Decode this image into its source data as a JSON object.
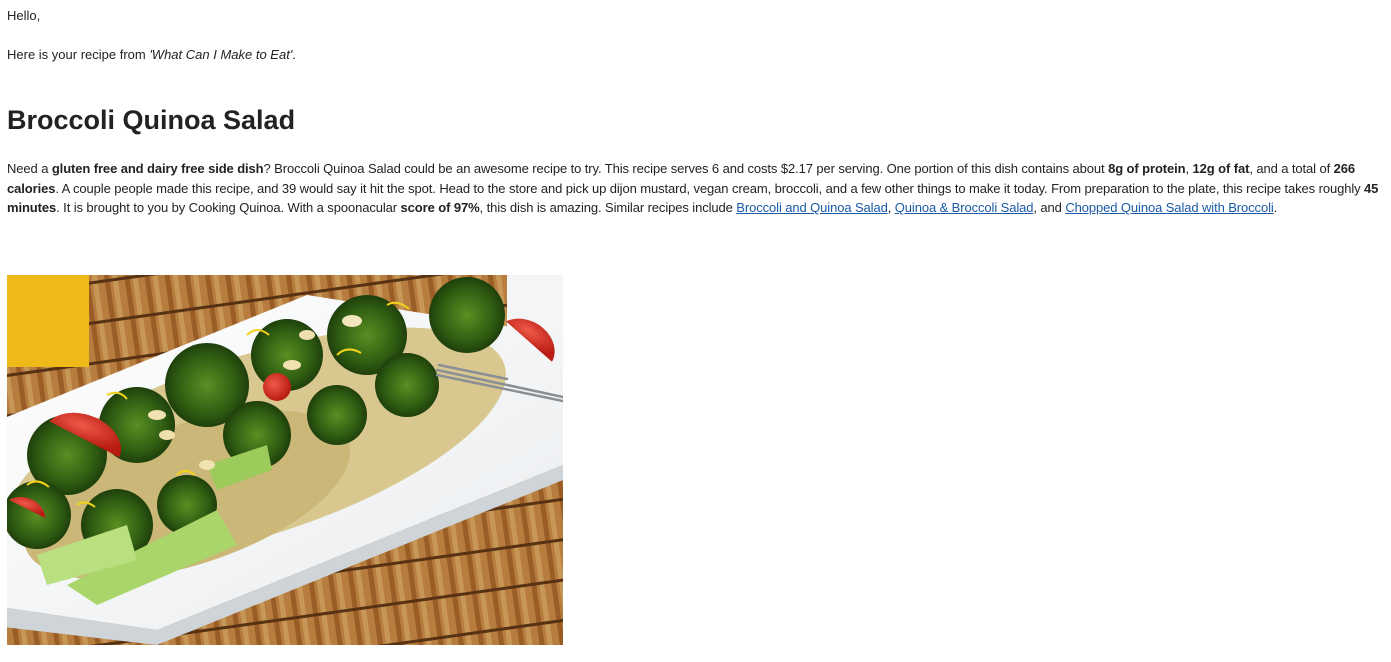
{
  "email": {
    "greeting": "Hello,",
    "intro_prefix": "Here is your recipe from ",
    "intro_source": "'What Can I Make to Eat'",
    "intro_suffix": "."
  },
  "recipe": {
    "title": "Broccoli Quinoa Salad",
    "description": {
      "t1": "Need a ",
      "b1": "gluten free and dairy free side dish",
      "t2": "? Broccoli Quinoa Salad could be an awesome recipe to try. This recipe serves 6 and costs $2.17 per serving. One portion of this dish contains about ",
      "b2": "8g of protein",
      "t3": ", ",
      "b3": "12g of fat",
      "t4": ", and a total of ",
      "b4": "266 calories",
      "t5": ". A couple people made this recipe, and 39 would say it hit the spot. Head to the store and pick up dijon mustard, vegan cream, broccoli, and a few other things to make it today. From preparation to the plate, this recipe takes roughly ",
      "b5": "45 minutes",
      "t6": ". It is brought to you by Cooking Quinoa. With a spoonacular ",
      "b6": "score of 97%",
      "t7": ", this dish is amazing. Similar recipes include ",
      "link1": "Broccoli and Quinoa Salad",
      "t8": ", ",
      "link2": "Quinoa & Broccoli Salad",
      "t9": ", and ",
      "link3": "Chopped Quinoa Salad with Broccoli",
      "t10": "."
    }
  },
  "image": {
    "alt": "Broccoli Quinoa Salad",
    "icon": "recipe-photo"
  },
  "colors": {
    "link": "#1a5aa6",
    "text": "#222222",
    "background": "#ffffff"
  }
}
